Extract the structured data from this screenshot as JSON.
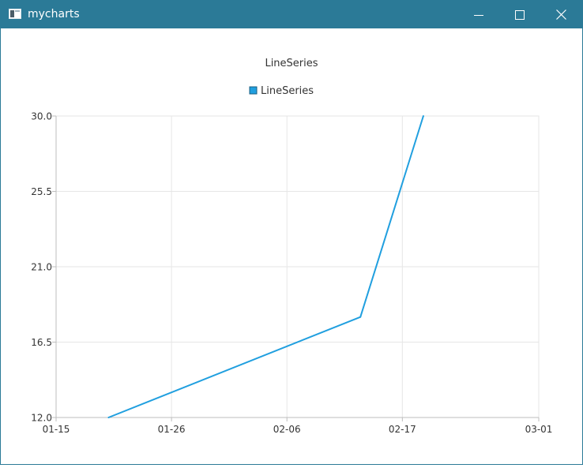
{
  "window": {
    "title": "mycharts",
    "icons": {
      "app": "app-window-icon",
      "minimize": "minimize-icon",
      "maximize": "maximize-icon",
      "close": "close-icon"
    },
    "titlebar_color": "#2b7a97"
  },
  "chart_data": {
    "type": "line",
    "title": "LineSeries",
    "legend": {
      "position": "top-center",
      "entries": [
        "LineSeries"
      ]
    },
    "x_axis": {
      "type": "date",
      "min": "01-15",
      "max": "03-01",
      "ticks": [
        "01-15",
        "01-26",
        "02-06",
        "02-17",
        "03-01"
      ]
    },
    "y_axis": {
      "min": 12.0,
      "max": 30.0,
      "ticks": [
        "12.0",
        "16.5",
        "21.0",
        "25.5",
        "30.0"
      ]
    },
    "grid": true,
    "series": [
      {
        "name": "LineSeries",
        "color": "#209fdf",
        "points": [
          {
            "x": "01-20",
            "y": 12.0
          },
          {
            "x": "02-13",
            "y": 18.0
          },
          {
            "x": "02-19",
            "y": 30.0
          }
        ]
      }
    ]
  }
}
